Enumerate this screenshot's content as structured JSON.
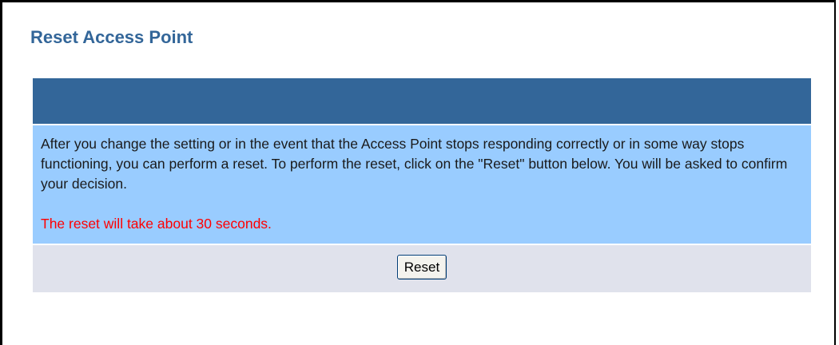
{
  "page": {
    "title": "Reset Access Point"
  },
  "panel": {
    "description": "After you change the setting or in the event that the Access Point stops responding correctly or in some way stops functioning, you can perform a reset. To perform the reset, click on the \"Reset\" button below. You will be asked to confirm your decision.",
    "warning": "The reset will take about 30 seconds.",
    "reset_label": "Reset"
  },
  "colors": {
    "title": "#336699",
    "header_bar": "#336699",
    "body_background": "#99ccff",
    "footer_background": "#e0e2ec",
    "warning_text": "#ff0000"
  }
}
